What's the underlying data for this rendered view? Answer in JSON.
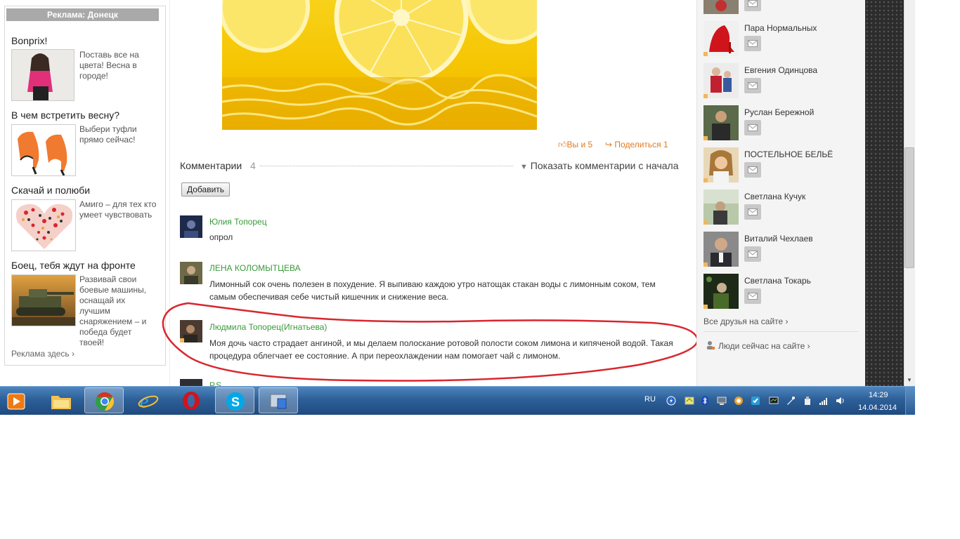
{
  "ads": {
    "header": "Реклама: Донецк",
    "items": [
      {
        "title": "Bonprix!",
        "text": "Поставь все на цвета! Весна в городе!"
      },
      {
        "title": "В чем встретить весну?",
        "text": "Выбери туфли прямо сейчас!"
      },
      {
        "title": "Скачай и полюби",
        "text": "Амиго – для тех кто умеет чувствовать"
      },
      {
        "title": "Боец, тебя ждут на фронте",
        "text": "Развивай свои боевые машины, оснащай их лучшим снаряжением – и победа будет твоей!"
      }
    ],
    "more": "Реклама здесь ›"
  },
  "post": {
    "likes": "Вы и 5",
    "share": "Поделиться 1"
  },
  "comments": {
    "label": "Комментарии",
    "count": "4",
    "show_from_start": "Показать комментарии с начала",
    "add_button": "Добавить",
    "items": [
      {
        "author": "Юлия Топорец",
        "text": "опрол"
      },
      {
        "author": "ЛЕНА КОЛОМЫТЦЕВА",
        "text": "Лимонный сок очень полезен в похудение. Я выпиваю каждою утро натощак стакан воды с лимонным соком, тем самым обеспечивая себе чистый кишечник и снижение веса."
      },
      {
        "author": "Людмила Топорец(Игнатьева)",
        "text": "Моя дочь часто страдает ангиной, и мы делаем полоскание  ротовой полости  соком лимона и кипяченой водой. Такая процедура облегчает ее состояние. А при переохлаждении нам помогает чай с лимоном."
      },
      {
        "author": "Р.S.",
        "text": ""
      }
    ]
  },
  "friends": {
    "items": [
      {
        "name": "Пара Нормальных"
      },
      {
        "name": "Евгения Одинцова"
      },
      {
        "name": "Руслан Бережной"
      },
      {
        "name": "ПОСТЕЛЬНОЕ БЕЛЬЁ"
      },
      {
        "name": "Светлана Кучук"
      },
      {
        "name": "Виталий Чехлаев"
      },
      {
        "name": "Светлана Токарь"
      }
    ],
    "all_friends": "Все друзья на сайте ›",
    "people_now": "Люди сейчас на сайте ›"
  },
  "taskbar": {
    "apps": [
      "media-player",
      "file-explorer",
      "chrome",
      "internet-explorer",
      "opera",
      "skype",
      "remote-desktop"
    ],
    "lang": "RU",
    "time": "14:29",
    "date": "14.04.2014"
  },
  "colors": {
    "accent_orange": "#e07a22",
    "author_green": "#3a9a3a",
    "annotation_red": "#d8262e"
  }
}
